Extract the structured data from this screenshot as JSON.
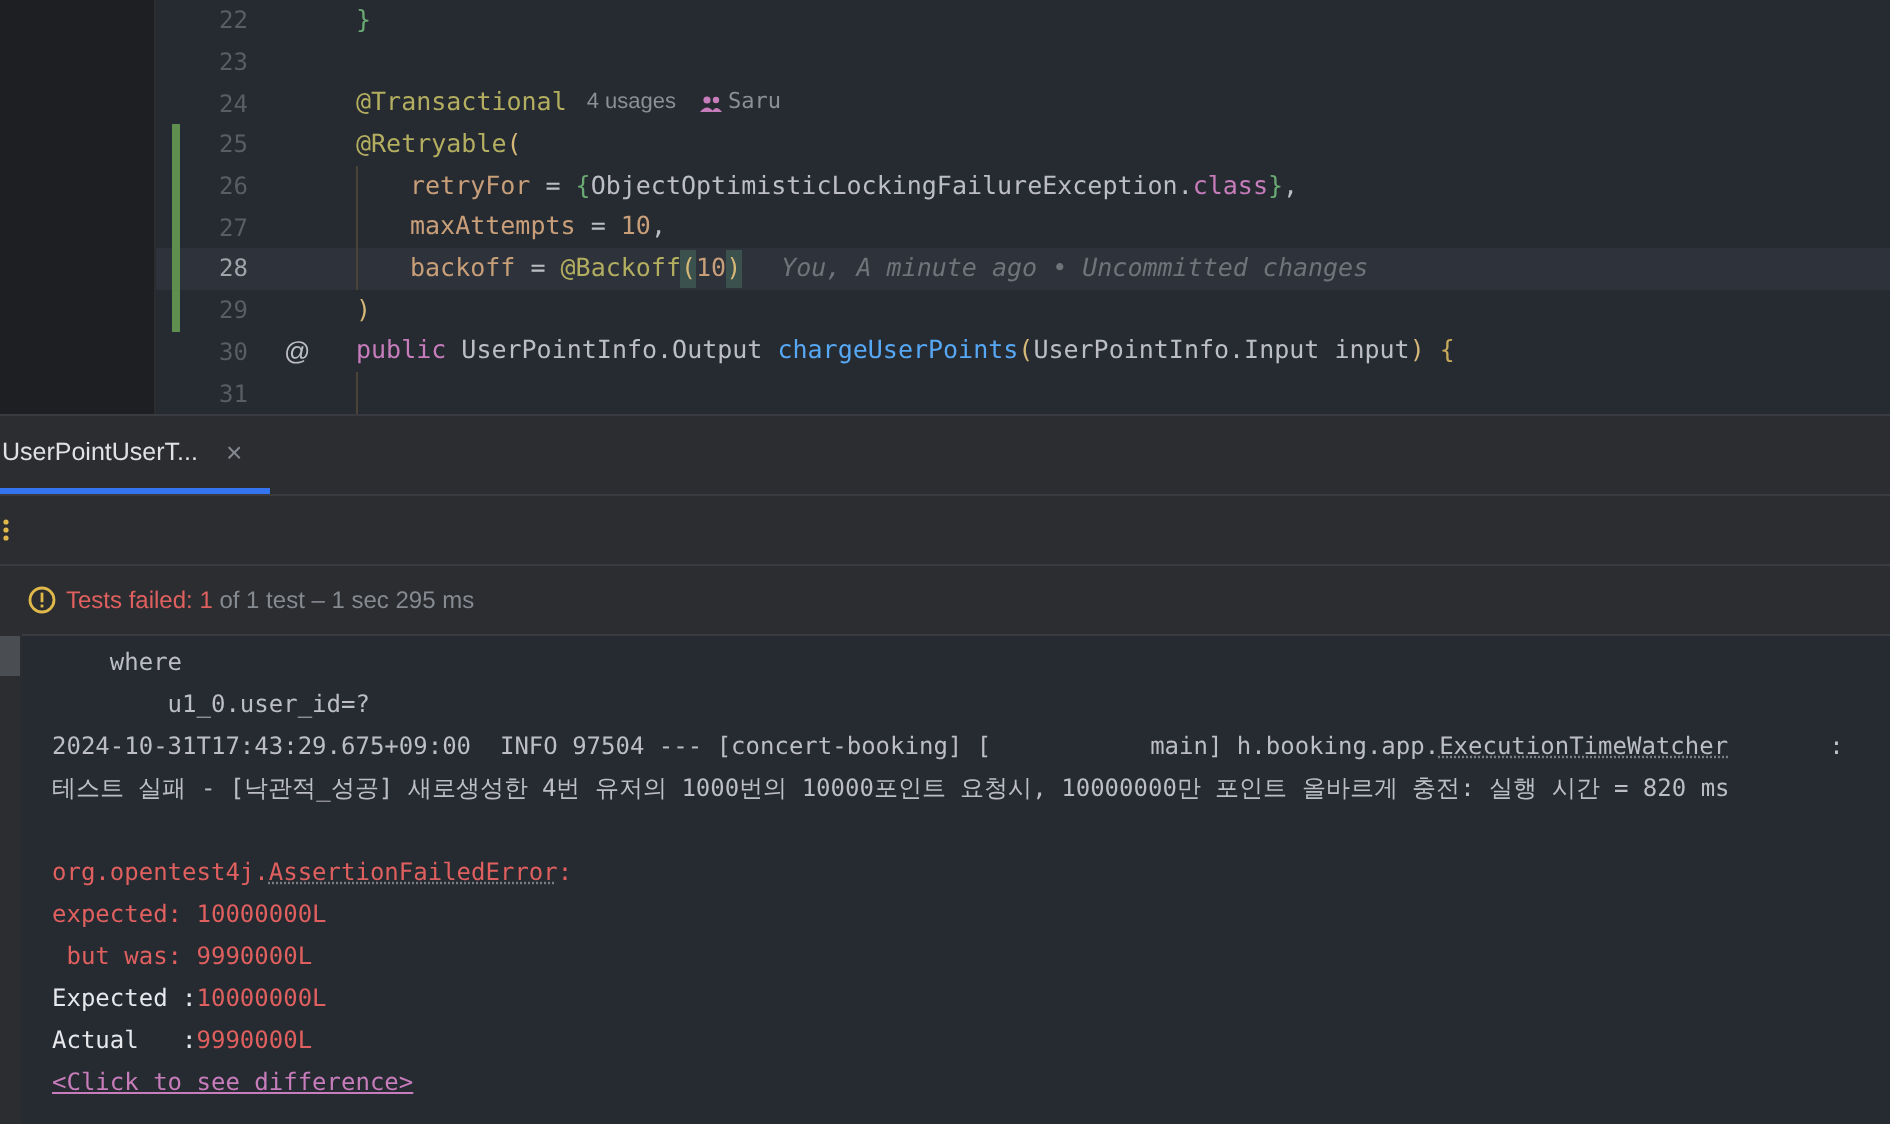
{
  "editor": {
    "lines": [
      {
        "number": "22",
        "changed": false,
        "current": false,
        "tokens": [
          {
            "kind": "brace",
            "text": "}"
          }
        ]
      },
      {
        "number": "23",
        "changed": false,
        "current": false
      },
      {
        "number": "24",
        "changed": false,
        "current": false,
        "tokens": [
          {
            "kind": "annotation",
            "text": "@Transactional"
          }
        ],
        "hints": [
          {
            "kind": "usages",
            "text": "4 usages"
          },
          {
            "kind": "author",
            "text": "Saru"
          }
        ]
      },
      {
        "number": "25",
        "changed": true,
        "current": false,
        "tokens": [
          {
            "kind": "annotation",
            "text": "@Retryable"
          },
          {
            "kind": "paren",
            "text": "("
          }
        ]
      },
      {
        "number": "26",
        "changed": true,
        "current": false,
        "indent": true,
        "tokens": [
          {
            "kind": "param",
            "text": "retryFor"
          },
          {
            "kind": "plain",
            "text": " = "
          },
          {
            "kind": "brace",
            "text": "{"
          },
          {
            "kind": "plain",
            "text": "ObjectOptimisticLockingFailureException."
          },
          {
            "kind": "keyword",
            "text": "class"
          },
          {
            "kind": "brace",
            "text": "}"
          },
          {
            "kind": "plain",
            "text": ","
          }
        ]
      },
      {
        "number": "27",
        "changed": true,
        "current": false,
        "indent": true,
        "tokens": [
          {
            "kind": "param",
            "text": "maxAttempts"
          },
          {
            "kind": "plain",
            "text": " = "
          },
          {
            "kind": "number",
            "text": "10"
          },
          {
            "kind": "plain",
            "text": ","
          }
        ]
      },
      {
        "number": "28",
        "changed": true,
        "current": true,
        "indent": true,
        "tokens": [
          {
            "kind": "param",
            "text": "backoff"
          },
          {
            "kind": "plain",
            "text": " = "
          },
          {
            "kind": "annotation",
            "text": "@Backoff"
          },
          {
            "kind": "paren-match",
            "text": "("
          },
          {
            "kind": "number",
            "text": "10"
          },
          {
            "kind": "paren-match",
            "text": ")"
          }
        ],
        "blame": "You, A minute ago • Uncommitted changes"
      },
      {
        "number": "29",
        "changed": true,
        "current": false,
        "tokens": [
          {
            "kind": "paren",
            "text": ")"
          }
        ]
      },
      {
        "number": "30",
        "changed": false,
        "current": false,
        "gutter_text": "@",
        "tokens": [
          {
            "kind": "keyword",
            "text": "public"
          },
          {
            "kind": "plain",
            "text": " UserPointInfo.Output "
          },
          {
            "kind": "method",
            "text": "chargeUserPoints"
          },
          {
            "kind": "paren",
            "text": "("
          },
          {
            "kind": "plain",
            "text": "UserPointInfo.Input input"
          },
          {
            "kind": "paren",
            "text": ")"
          },
          {
            "kind": "brace2",
            "text": " {"
          }
        ]
      },
      {
        "number": "31",
        "changed": false,
        "current": false,
        "indent": true
      }
    ]
  },
  "run_panel": {
    "tabs": [
      {
        "label": "UserPointUserT...",
        "selected": true,
        "close": "×"
      }
    ],
    "status": {
      "failed": "Tests failed: 1",
      "rest": " of 1 test – 1 sec 295 ms"
    },
    "console": [
      {
        "kind": "output",
        "lines": [
          [
            {
              "kind": "plain",
              "text": "    where"
            }
          ],
          [
            {
              "kind": "plain",
              "text": "        u1_0.user_id=?"
            }
          ],
          [
            {
              "kind": "plain",
              "text": "2024-10-31T17:43:29.675+09:00  INFO 97504 --- [concert-booking] [           main] h.booking.app."
            },
            {
              "kind": "plain-ref",
              "text": "ExecutionTimeWatcher"
            },
            {
              "kind": "plain",
              "text": "       :"
            }
          ],
          [
            {
              "kind": "plain",
              "text": "테스트 실패 - [낙관적_성공] 새로생성한 4번 유저의 1000번의 10000포인트 요청시, 10000000만 포인트 올바르게 충전: 실행 시간 = 820 ms"
            }
          ]
        ]
      },
      {
        "kind": "failure",
        "lines": [
          [
            {
              "kind": "error",
              "text": "org.opentest4j."
            },
            {
              "kind": "error-ref",
              "text": "AssertionFailedError"
            },
            {
              "kind": "error",
              "text": ":"
            }
          ],
          [
            {
              "kind": "error",
              "text": "expected: 10000000L"
            }
          ],
          [
            {
              "kind": "error",
              "text": " but was: 9990000L"
            }
          ],
          [
            {
              "kind": "bright",
              "text": "Expected :"
            },
            {
              "kind": "error",
              "text": "10000000L"
            }
          ],
          [
            {
              "kind": "bright",
              "text": "Actual   :"
            },
            {
              "kind": "error",
              "text": "9990000L"
            }
          ],
          [
            {
              "kind": "link",
              "text": "<Click to see difference>"
            }
          ]
        ]
      }
    ]
  }
}
